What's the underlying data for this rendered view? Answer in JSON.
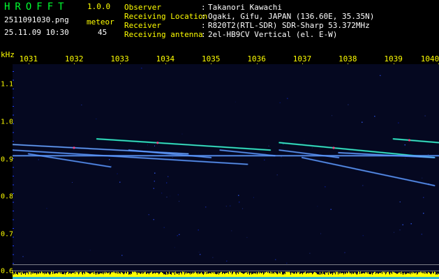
{
  "header": {
    "app_title": "HROFFT",
    "version": "1.0.0",
    "file_name": "2511091030.png",
    "meteor_label": "meteor",
    "time": "25.11.09 10:30",
    "meteor_count": "45"
  },
  "info": {
    "observer_key": "Observer",
    "observer_val": "Takanori Kawachi",
    "location_key": "Receiving Location",
    "location_val": "Ogaki, Gifu, JAPAN (136.60E, 35.35N)",
    "receiver_key": "Receiver",
    "receiver_val": "R820T2(RTL-SDR) SDR-Sharp 53.372MHz",
    "antenna_key": "Receiving antenna",
    "antenna_val": "2el-HB9CV Vertical (el. E-W)",
    "colon": ":"
  },
  "axes": {
    "y_unit": "kHz",
    "x_ticks": [
      "1031",
      "1032",
      "1033",
      "1034",
      "1035",
      "1036",
      "1037",
      "1038",
      "1039",
      "1040"
    ],
    "y_ticks": [
      "1.1",
      "1.0",
      "0.9",
      "0.8",
      "0.7",
      "0.6"
    ]
  },
  "colors": {
    "title": "#00ff30",
    "label": "#ffff00",
    "text": "#ffffff",
    "background": "#000000",
    "spectrogram_bg": "#050820",
    "trail_strong": "#ff4080",
    "trail_mid": "#00ffc0",
    "trail_weak": "#4080ff",
    "power_bar": "#ffff00"
  },
  "chart_data": {
    "type": "heatmap",
    "title": "",
    "xlabel": "",
    "ylabel": "kHz",
    "x_ticks": [
      1031,
      1032,
      1033,
      1034,
      1035,
      1036,
      1037,
      1038,
      1039,
      1040
    ],
    "y_ticks": [
      1.1,
      1.0,
      0.9,
      0.8,
      0.7,
      0.6
    ],
    "xlim": [
      1030.65,
      1040.0
    ],
    "ylim": [
      0.58,
      1.155
    ],
    "carrier_khz": 0.91,
    "trails": [
      {
        "x": [
          1030.65,
          1034.5
        ],
        "y": [
          0.94,
          0.915
        ],
        "intensity": 0.8
      },
      {
        "x": [
          1030.65,
          1035.8
        ],
        "y": [
          0.925,
          0.887
        ],
        "intensity": 0.6
      },
      {
        "x": [
          1031.0,
          1032.8
        ],
        "y": [
          0.915,
          0.88
        ],
        "intensity": 0.5
      },
      {
        "x": [
          1032.5,
          1036.3
        ],
        "y": [
          0.955,
          0.925
        ],
        "intensity": 0.85
      },
      {
        "x": [
          1033.2,
          1035.0
        ],
        "y": [
          0.925,
          0.905
        ],
        "intensity": 0.6
      },
      {
        "x": [
          1035.2,
          1036.4
        ],
        "y": [
          0.925,
          0.91
        ],
        "intensity": 0.6
      },
      {
        "x": [
          1036.5,
          1039.9
        ],
        "y": [
          0.945,
          0.905
        ],
        "intensity": 0.9
      },
      {
        "x": [
          1036.5,
          1037.8
        ],
        "y": [
          0.925,
          0.905
        ],
        "intensity": 0.6
      },
      {
        "x": [
          1037.0,
          1039.9
        ],
        "y": [
          0.905,
          0.83
        ],
        "intensity": 0.6
      },
      {
        "x": [
          1037.8,
          1039.9
        ],
        "y": [
          0.918,
          0.905
        ],
        "intensity": 0.7
      },
      {
        "x": [
          1039.0,
          1040.0
        ],
        "y": [
          0.955,
          0.945
        ],
        "intensity": 0.9
      },
      {
        "x": [
          1030.65,
          1040.0
        ],
        "y": [
          0.91,
          0.91
        ],
        "intensity": 0.7
      }
    ],
    "lower_lines_khz": [
      0.618,
      0.602
    ],
    "power_bar_khz": [
      0.58,
      0.6
    ]
  }
}
